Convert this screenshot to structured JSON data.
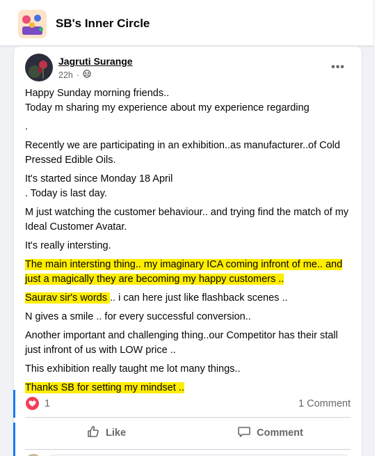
{
  "group": {
    "name": "SB's Inner Circle",
    "thumb_icon": "group-cover-thumbnail"
  },
  "post": {
    "author": "Jagruti Surange",
    "time": "22h",
    "audience_icon": "members-globe-icon",
    "more_icon": "more-options-icon",
    "more_label": "•••",
    "paragraphs": [
      {
        "lines": [
          "Happy Sunday morning friends..",
          "Today m sharing my experience about  my experience regarding"
        ]
      },
      {
        "lines": [
          "."
        ]
      },
      {
        "lines": [
          "Recently we are participating in an exhibition..as manufacturer..of Cold Pressed Edible Oils."
        ]
      },
      {
        "lines": [
          "It's started since Monday 18 April",
          ". Today is last day."
        ]
      },
      {
        "lines": [
          "M just watching the customer behaviour.. and trying find the match of my Ideal Customer Avatar."
        ]
      },
      {
        "lines": [
          "It's really intersting."
        ]
      },
      {
        "highlight": "The main intersting thing.. my imaginary ICA  coming infront of me.. and just a magically they are becoming my happy customers .. "
      },
      {
        "highlight": "Saurav sir's words ",
        "rest": ".. i can here just like flashback scenes .."
      },
      {
        "lines": [
          "N gives a smile .. for every successful conversion.."
        ]
      },
      {
        "lines": [
          "Another important and challenging  thing..our Competitor has their stall just infront of us with LOW  price .."
        ]
      },
      {
        "lines": [
          "This exhibition really taught me lot many things.."
        ]
      },
      {
        "highlight": "Thanks SB for setting my mindset .."
      }
    ],
    "reactions": {
      "icon": "love-reaction-icon",
      "count": "1"
    },
    "comment_count": "1 Comment",
    "actions": {
      "like_label": "Like",
      "like_icon": "thumbs-up-icon",
      "comment_label": "Comment",
      "comment_icon": "comment-bubble-icon"
    }
  },
  "colors": {
    "highlight": "#ffed00",
    "accent": "#1877f2",
    "love": "#f33e58",
    "muted_text": "#65676b"
  }
}
